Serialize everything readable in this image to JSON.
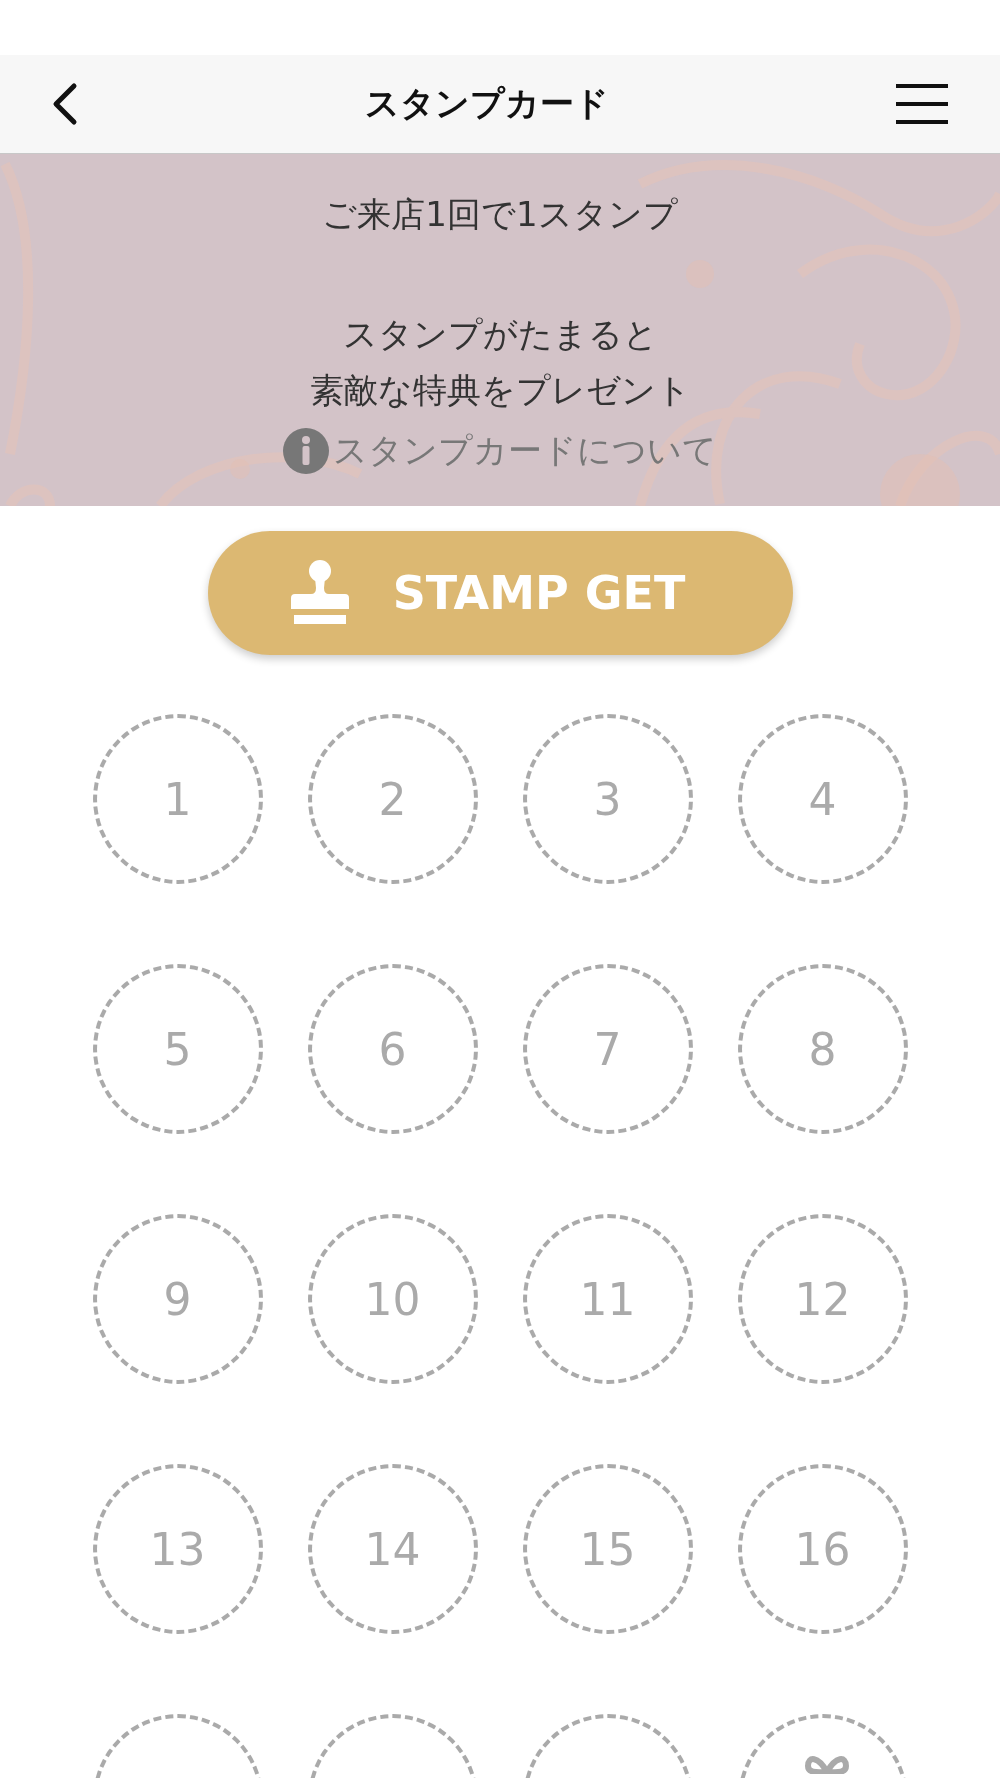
{
  "header": {
    "title": "スタンプカード"
  },
  "banner": {
    "lines": [
      "ご来店1回で1スタンプ",
      "スタンプがたまると",
      "素敵な特典をプレゼント"
    ],
    "info_link": "スタンプカードについて"
  },
  "stamp_button": {
    "label": "STAMP GET"
  },
  "stamps": [
    {
      "kind": "number",
      "label": "1"
    },
    {
      "kind": "number",
      "label": "2"
    },
    {
      "kind": "number",
      "label": "3"
    },
    {
      "kind": "number",
      "label": "4"
    },
    {
      "kind": "number",
      "label": "5"
    },
    {
      "kind": "number",
      "label": "6"
    },
    {
      "kind": "number",
      "label": "7"
    },
    {
      "kind": "number",
      "label": "8"
    },
    {
      "kind": "number",
      "label": "9"
    },
    {
      "kind": "number",
      "label": "10"
    },
    {
      "kind": "number",
      "label": "11"
    },
    {
      "kind": "number",
      "label": "12"
    },
    {
      "kind": "number",
      "label": "13"
    },
    {
      "kind": "number",
      "label": "14"
    },
    {
      "kind": "number",
      "label": "15"
    },
    {
      "kind": "number",
      "label": "16"
    },
    {
      "kind": "blank"
    },
    {
      "kind": "blank"
    },
    {
      "kind": "blank"
    },
    {
      "kind": "gift"
    }
  ]
}
